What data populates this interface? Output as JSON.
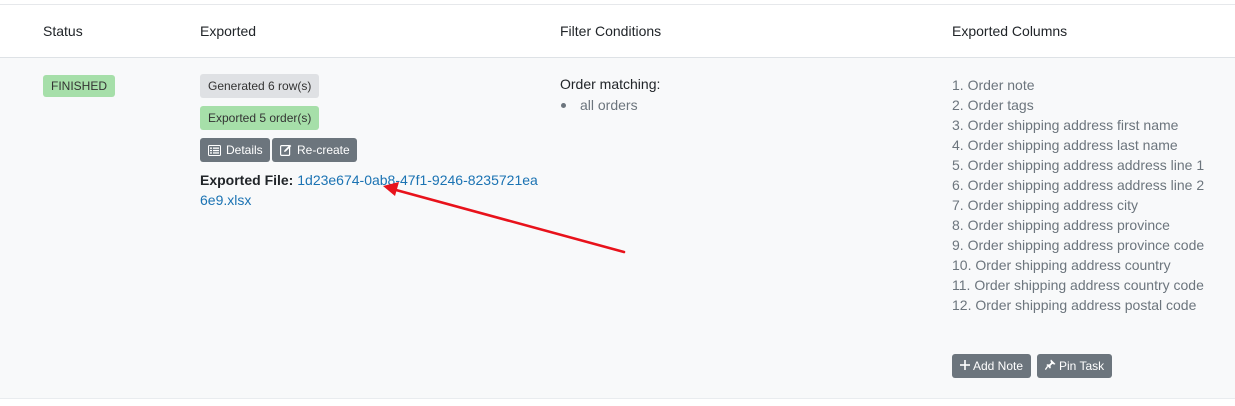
{
  "table": {
    "headers": {
      "status": "Status",
      "exported": "Exported",
      "filter": "Filter Conditions",
      "columns": "Exported Columns"
    }
  },
  "row": {
    "status": "FINISHED",
    "generated": "Generated 6 row(s)",
    "exported_orders": "Exported 5 order(s)",
    "details_label": "Details",
    "recreate_label": "Re-create",
    "exported_file_label": "Exported File:",
    "exported_file_name": "1d23e674-0ab8-47f1-9246-8235721ea6e9.xlsx",
    "filter_title": "Order matching:",
    "filter_items": [
      "all orders"
    ],
    "columns": [
      "1. Order note",
      "2. Order tags",
      "3. Order shipping address first name",
      "4. Order shipping address last name",
      "5. Order shipping address address line 1",
      "6. Order shipping address address line 2",
      "7. Order shipping address city",
      "8. Order shipping address province",
      "9. Order shipping address province code",
      "10. Order shipping address country",
      "11. Order shipping address country code",
      "12. Order shipping address postal code"
    ],
    "add_note_label": "Add Note",
    "pin_task_label": "Pin Task"
  },
  "colors": {
    "finished_badge": "#a6dfa9",
    "button": "#6c757d",
    "link": "#1b73b3",
    "annotation_arrow": "#e8121b"
  }
}
